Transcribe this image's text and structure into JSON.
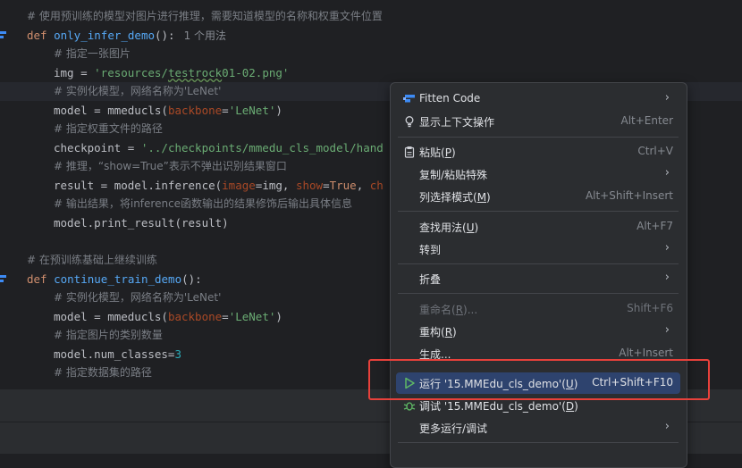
{
  "code": {
    "line1": "# 使用预训练的模型对图片进行推理，需要知道模型的名称和权重文件位置",
    "line2_def": "def ",
    "line2_fn": "only_infer_demo",
    "line2_tail": "():",
    "line2_hint": "1 个用法",
    "line3": "# 指定一张图片",
    "line4_a": "img = ",
    "line4_str_a": "'resources/",
    "line4_str_b": "testrock",
    "line4_str_c": "01-02.png'",
    "line5": "# 实例化模型，网络名称为'LeNet'",
    "line6_a": "model = mmeduc",
    "line6_b": "ls(",
    "line6_param": "backbone",
    "line6_eq": "=",
    "line6_str": "'LeNet'",
    "line6_close": ")",
    "line7": "# 指定权重文件的路径",
    "line8_a": "checkpoint = ",
    "line8_str": "'../checkpoints/mmedu_cls_model/hand",
    "line9": "# 推理，“show=True”表示不弹出识别结果窗口",
    "line10_a": "result = model.inference(",
    "line10_p1": "image",
    "line10_b": "=img, ",
    "line10_p2": "show",
    "line10_c": "=",
    "line10_kw": "True",
    "line10_d": ", ",
    "line10_p3": "ch",
    "line11": "# 输出结果，将inference函数输出的结果修饰后输出具体信息",
    "line12": "model.print_result(result)",
    "line14": "# 在预训练基础上继续训练",
    "line15_def": "def ",
    "line15_fn": "continue_train_demo",
    "line15_tail": "():",
    "line16": "# 实例化模型，网络名称为'LeNet'",
    "line17_a": "model = mmeduc",
    "line17_b": "ls(",
    "line17_param": "backbone",
    "line17_eq": "=",
    "line17_str": "'LeNet'",
    "line17_close": ")",
    "line18": "# 指定图片的类别数量",
    "line19_a": "model.num_classes=",
    "line19_num": "3",
    "line20": "# 指定数据集的路径"
  },
  "menu": {
    "fitten": "Fitten Code",
    "context_actions": "显示上下文操作",
    "context_actions_sc": "Alt+Enter",
    "paste": "粘贴(",
    "paste_key": "P",
    "paste_tail": ")",
    "paste_sc": "Ctrl+V",
    "copy_paste_special": "复制/粘贴特殊",
    "column_mode": "列选择模式(",
    "column_mode_key": "M",
    "column_mode_tail": ")",
    "column_mode_sc": "Alt+Shift+Insert",
    "find_usages": "查找用法(",
    "find_usages_key": "U",
    "find_usages_tail": ")",
    "find_usages_sc": "Alt+F7",
    "goto": "转到",
    "fold": "折叠",
    "rename": "重命名(",
    "rename_key": "R",
    "rename_tail": ")...",
    "rename_sc": "Shift+F6",
    "refactor": "重构(",
    "refactor_key": "R",
    "refactor_tail": ")",
    "generate": "生成...",
    "generate_sc": "Alt+Insert",
    "run": "运行 '15.MMEdu_cls_demo'(",
    "run_key": "U",
    "run_tail": ")",
    "run_sc": "Ctrl+Shift+F10",
    "debug": "调试 '15.MMEdu_cls_demo'(",
    "debug_key": "D",
    "debug_tail": ")",
    "more_run": "更多运行/调试"
  },
  "colors": {
    "highlight": "#2e436e",
    "red_box": "#e8413b",
    "run_icon": "#5fb865"
  }
}
